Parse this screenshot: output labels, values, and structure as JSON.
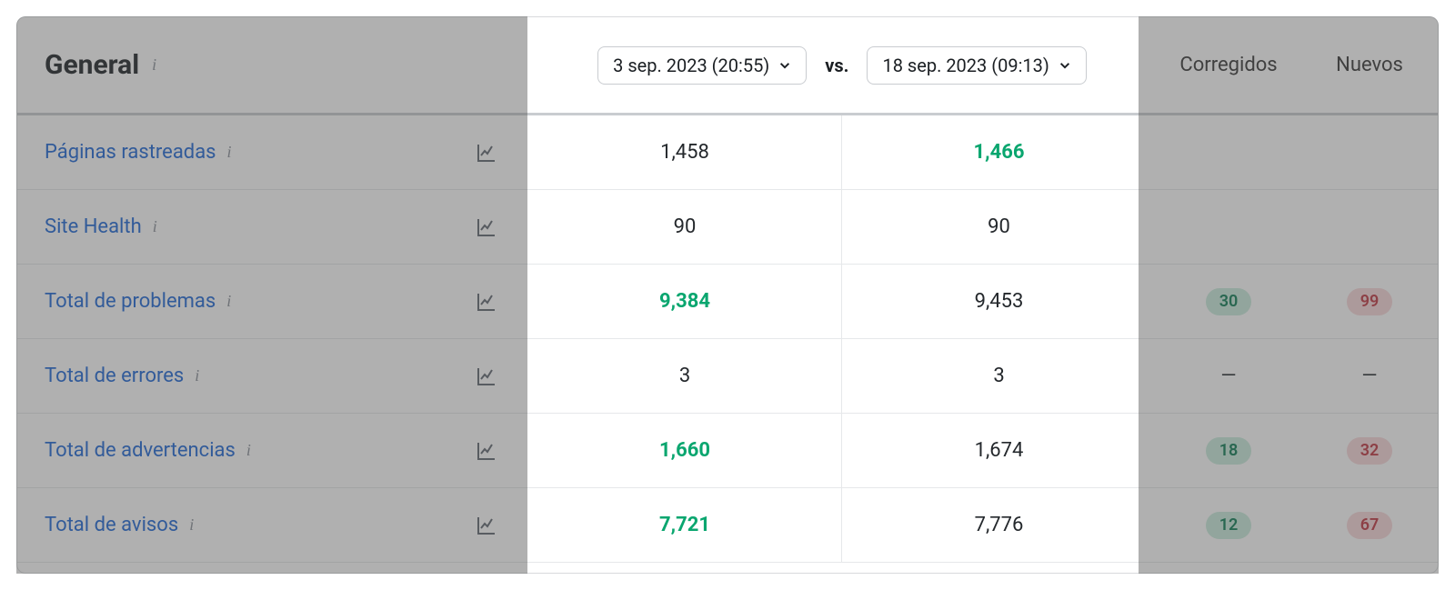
{
  "header": {
    "title": "General",
    "date_a": "3 sep. 2023 (20:55)",
    "vs": "vs.",
    "date_b": "18 sep. 2023 (09:13)",
    "fixed_label": "Corregidos",
    "new_label": "Nuevos"
  },
  "rows": [
    {
      "label": "Páginas rastreadas",
      "val_a": "1,458",
      "val_b": "1,466",
      "a_green": false,
      "b_green": true,
      "fixed": null,
      "new": null
    },
    {
      "label": "Site Health",
      "val_a": "90",
      "val_b": "90",
      "a_green": false,
      "b_green": false,
      "fixed": null,
      "new": null
    },
    {
      "label": "Total de problemas",
      "val_a": "9,384",
      "val_b": "9,453",
      "a_green": true,
      "b_green": false,
      "fixed": "30",
      "new": "99"
    },
    {
      "label": "Total de errores",
      "val_a": "3",
      "val_b": "3",
      "a_green": false,
      "b_green": false,
      "fixed": "—",
      "new": "—"
    },
    {
      "label": "Total de advertencias",
      "val_a": "1,660",
      "val_b": "1,674",
      "a_green": true,
      "b_green": false,
      "fixed": "18",
      "new": "32"
    },
    {
      "label": "Total de avisos",
      "val_a": "7,721",
      "val_b": "7,776",
      "a_green": true,
      "b_green": false,
      "fixed": "12",
      "new": "67"
    }
  ]
}
